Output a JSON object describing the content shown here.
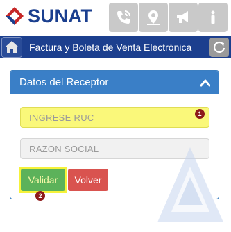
{
  "header": {
    "brand": "SUNAT",
    "icons": [
      "phone-icon",
      "map-pin-icon",
      "megaphone-icon",
      "info-icon"
    ]
  },
  "titlebar": {
    "title": "Factura y Boleta de Venta Electrónica"
  },
  "card": {
    "title": "Datos del Receptor",
    "ruc_placeholder": "INGRESE RUC",
    "razon_placeholder": "RAZON SOCIAL",
    "validar_label": "Validar",
    "volver_label": "Volver",
    "badge_1": "1",
    "badge_2": "2"
  },
  "colors": {
    "brand_blue": "#1c3f8e",
    "card_header": "#3a7fc7",
    "highlight_yellow": "#faf87a",
    "validar_green": "#5cb25a",
    "volver_red": "#d9534f",
    "badge_red": "#8e1b1b"
  }
}
